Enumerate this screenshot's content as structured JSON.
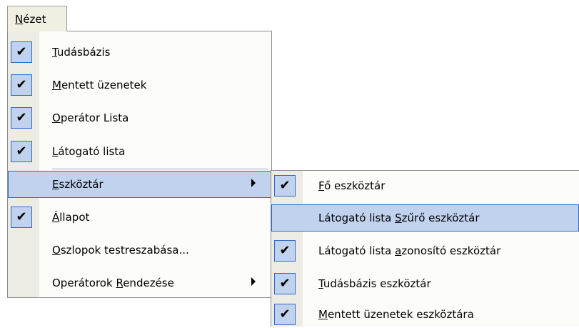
{
  "menubar": {
    "nezet": {
      "pre": "",
      "mn": "N",
      "post": "ézet"
    }
  },
  "main_menu": {
    "items": [
      {
        "pre": "",
        "mn": "T",
        "post": "udásbázis",
        "checked": true
      },
      {
        "pre": "",
        "mn": "M",
        "post": "entett üzenetek",
        "checked": true
      },
      {
        "pre": "",
        "mn": "O",
        "post": "perátor Lista",
        "checked": true
      },
      {
        "pre": "",
        "mn": "L",
        "post": "átogató lista",
        "checked": true
      },
      {
        "pre": "",
        "mn": "E",
        "post": "szköztár",
        "checked": false,
        "submenu": true,
        "highlighted": true
      },
      {
        "pre": "",
        "mn": "Á",
        "post": "llapot",
        "checked": true
      },
      {
        "pre": "",
        "mn": "O",
        "post": "szlopok testreszabása...",
        "checked": false
      },
      {
        "pre": "Operátorok ",
        "mn": "R",
        "post": "endezése",
        "checked": false,
        "submenu": true
      }
    ]
  },
  "sub_menu": {
    "items": [
      {
        "pre": "",
        "mn": "F",
        "post": "ő eszköztár",
        "checked": true
      },
      {
        "pre": "Látogató lista ",
        "mn": "S",
        "post": "zűrő eszköztár",
        "checked": false,
        "highlighted": true
      },
      {
        "pre": "Látogató lista ",
        "mn": "a",
        "post": "zonosító eszköztár",
        "checked": true
      },
      {
        "pre": "",
        "mn": "T",
        "post": "udásbázis eszköztár",
        "checked": true
      },
      {
        "pre": "",
        "mn": "M",
        "post": "entett üzenetek eszköztára",
        "checked": true
      }
    ]
  },
  "icons": {
    "check": "✔"
  },
  "colors": {
    "highlight": "#c1d2ee",
    "highlight_border": "#316ac5",
    "gutter": "#ecebe4",
    "menu_bg": "#fcfcf9"
  }
}
